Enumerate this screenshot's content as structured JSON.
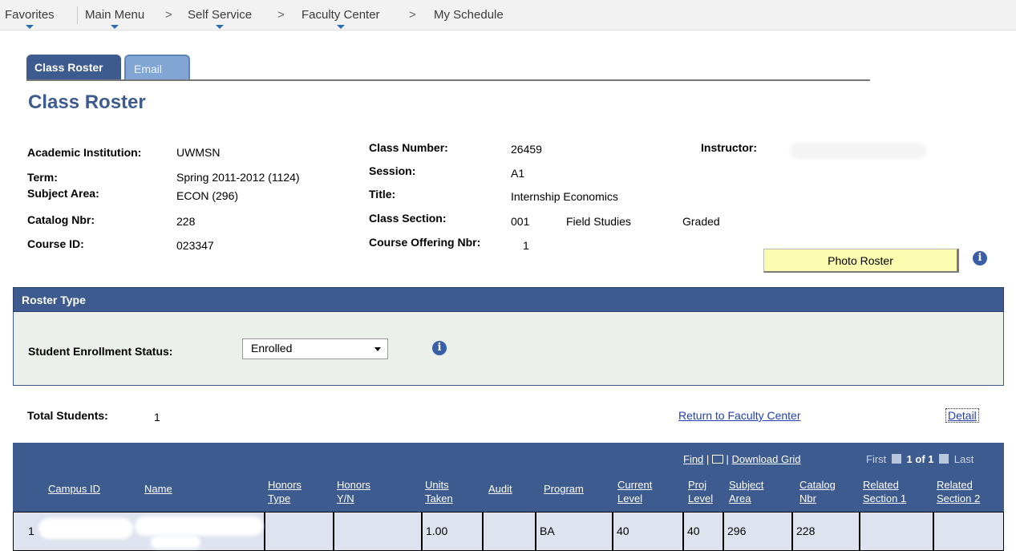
{
  "breadcrumb": {
    "favorites": "Favorites",
    "main_menu": "Main Menu",
    "self_service": "Self Service",
    "faculty_center": "Faculty Center",
    "my_schedule": "My Schedule",
    "separator": ">"
  },
  "tabs": [
    {
      "label": "Class Roster",
      "active": true
    },
    {
      "label": "Email",
      "active": false
    }
  ],
  "page_title": "Class Roster",
  "info": {
    "academic_institution_label": "Academic Institution:",
    "academic_institution": "UWMSN",
    "term_label": "Term:",
    "term": "Spring 2011-2012 (1124)",
    "subject_area_label": "Subject Area:",
    "subject_area": "ECON (296)",
    "catalog_nbr_label": "Catalog Nbr:",
    "catalog_nbr": "228",
    "course_id_label": "Course ID:",
    "course_id": "023347",
    "class_number_label": "Class Number:",
    "class_number": "26459",
    "session_label": "Session:",
    "session": "A1",
    "title_label": "Title:",
    "title": "Internship Economics",
    "class_section_label": "Class Section:",
    "class_section": "001",
    "section_type": "Field Studies",
    "grading": "Graded",
    "course_offering_nbr_label": "Course Offering Nbr:",
    "course_offering_nbr": "1",
    "instructor_label": "Instructor:"
  },
  "photo_roster_label": "Photo Roster",
  "roster_type": {
    "header": "Roster Type",
    "status_label": "Student Enrollment Status:",
    "status_value": "Enrolled"
  },
  "total_students_label": "Total Students:",
  "total_students": "1",
  "return_link": "Return to Faculty Center",
  "detail_link": "Detail",
  "grid": {
    "find": "Find",
    "download": "Download Grid",
    "first": "First",
    "pager": "1 of 1",
    "last": "Last",
    "columns": [
      "Campus ID",
      "Name",
      "Honors Type",
      "Honors Y/N",
      "Units Taken",
      "Audit",
      "Program",
      "Current Level",
      "Proj Level",
      "Subject Area",
      "Catalog Nbr",
      "Related Section 1",
      "Related Section 2"
    ],
    "row": {
      "index": "1",
      "honors_type": "",
      "honors_yn": "",
      "units_taken": "1.00",
      "audit": "",
      "program": "BA",
      "current_level": "40",
      "proj_level": "40",
      "subject_area": "296",
      "catalog_nbr": "228",
      "related_1": "",
      "related_2": ""
    }
  },
  "colors": {
    "header_blue": "#3e5b8f",
    "link_blue": "#2340b8",
    "button_yellow": "#fcfcb0",
    "panel_bg": "#ecf0ea",
    "row_bg": "#dee3ef"
  }
}
